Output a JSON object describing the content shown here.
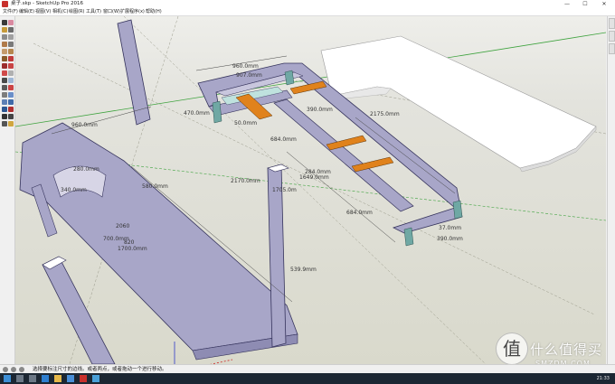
{
  "window": {
    "title": "桌子.skp - SketchUp Pro 2016",
    "controls": {
      "minimize": "—",
      "maximize": "☐",
      "close": "✕"
    }
  },
  "menu": [
    "文件(F)",
    "编辑(E)",
    "视图(V)",
    "相机(C)",
    "绘图(R)",
    "工具(T)",
    "窗口(W)",
    "扩展程序(x)",
    "帮助(H)"
  ],
  "toolbar": {
    "tools": [
      "select-icon",
      "eraser-icon",
      "paint-icon",
      "line-icon",
      "arc-icon",
      "rectangle-icon",
      "circle-icon",
      "polygon-icon",
      "freehand-icon",
      "push-pull-icon",
      "move-icon",
      "rotate-icon",
      "scale-icon",
      "offset-icon",
      "follow-me-icon",
      "tape-measure-icon",
      "dimension-icon",
      "protractor-icon",
      "text-icon",
      "axes-icon",
      "3d-text-icon",
      "orbit-icon",
      "pan-icon",
      "zoom-icon",
      "zoom-window-icon",
      "zoom-extents-icon",
      "walk-icon",
      "position-camera-icon",
      "look-around-icon",
      "section-plane-icon"
    ]
  },
  "dimensions": {
    "d_960_left": "960.0mm",
    "d_280": "280.0mm",
    "d_340": "340.0mm",
    "d_580": "580.0mm",
    "d_2170": "2170.0mm",
    "d_1705": "1705.0m",
    "d_2060": "2060",
    "d_700": "700.0mm",
    "d_820": "820",
    "d_1700": "1700.0mm",
    "d_539": "539.9mm",
    "d_960_top": "960.0mm",
    "d_907": "907.0mm",
    "d_470": "470.0mm",
    "d_390_top": "390.0mm",
    "d_2175": "2175.0mm",
    "d_50": "50.0mm",
    "d_684_a": "684.0mm",
    "d_284": "284.0mm",
    "d_1649": "1649.0mm",
    "d_684_b": "684.0mm",
    "d_37": "37.0mm",
    "d_390_bot": "390.0mm"
  },
  "statusbar": {
    "icons": [
      "info-icon",
      "geo-icon",
      "credits-icon"
    ],
    "text": "选择要标注尺寸的边线。或者两点，或者拖动一个进行移动。"
  },
  "taskbar": {
    "apps": [
      "windows-start-icon",
      "search-icon",
      "task-view-icon",
      "edge-icon",
      "explorer-icon",
      "store-icon",
      "sketchup-icon",
      "photos-icon"
    ],
    "clock": "21:33"
  },
  "watermark": {
    "badge": "值",
    "text": "什么值得买",
    "sub": "SMZDM.COM"
  },
  "colors": {
    "frame_fill": "#a8a6c8",
    "frame_stroke": "#35335c",
    "orange_beam": "#e0821c",
    "teal_leg": "#6fa8a4",
    "green_axis": "#3fa33f",
    "red_axis": "#cc2222",
    "blue_axis": "#2f39c8"
  }
}
